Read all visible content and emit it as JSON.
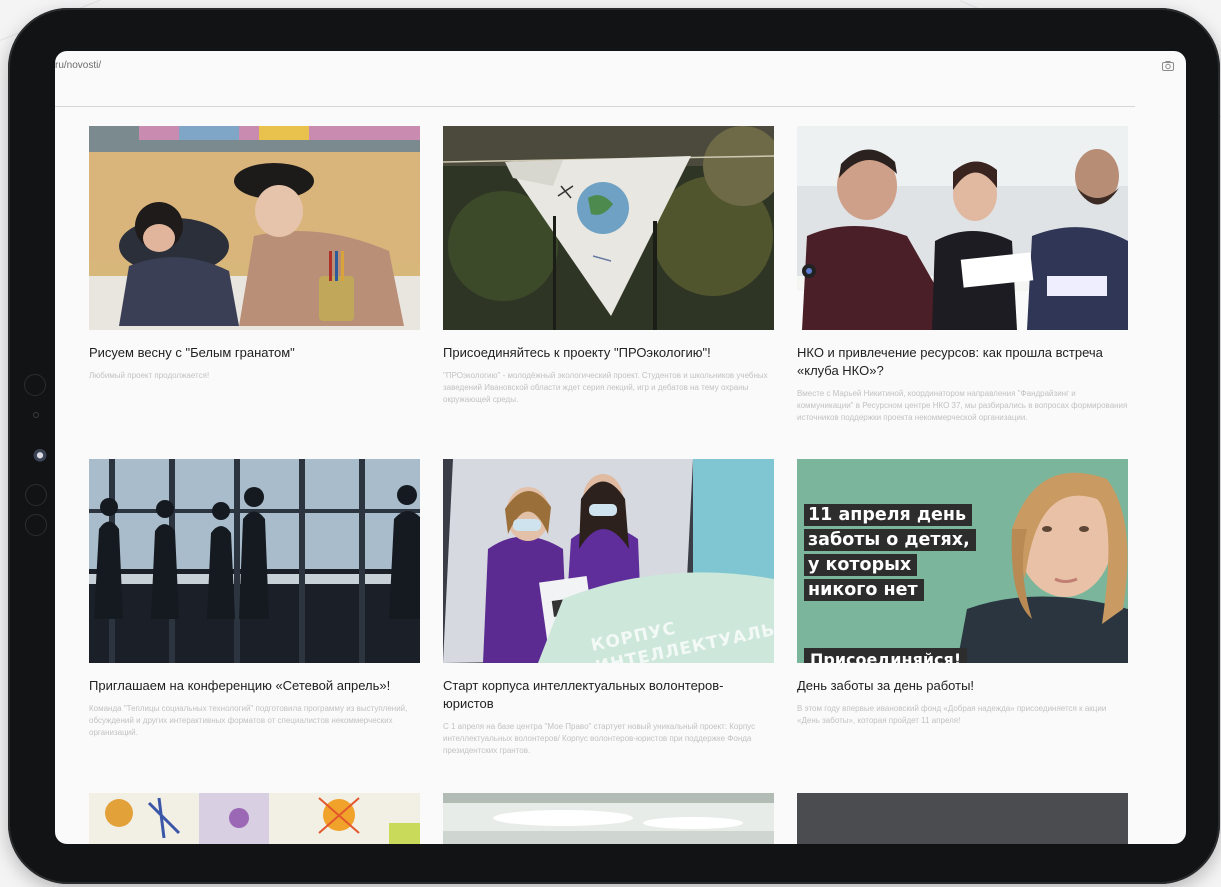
{
  "browser": {
    "url": "ru/novosti/",
    "screenshot_icon": "camera-icon"
  },
  "news": [
    {
      "title": "Рисуем весну с \"Белым гранатом\"",
      "desc": "Любимый проект продолжается!"
    },
    {
      "title": "Присоединяйтесь к проекту \"ПРОэкологию\"!",
      "desc": "\"ПРОэкологию\" - молодёжный экологический проект. Студентов и школьников учебных заведений Ивановской области ждет серия лекций, игр и дебатов на тему охраны окружающей среды."
    },
    {
      "title": "НКО и привлечение ресурсов: как прошла встреча «клуба НКО»?",
      "desc": "Вместе с Марьей Никитиной, координатором направления \"Фандрайзинг и коммуникации\" в Ресурсном центре НКО 37, мы разбирались в вопросах формирования источников поддержки проекта некоммерческой организации."
    },
    {
      "title": "Приглашаем на конференцию «Сетевой апрель»!",
      "desc": "Команда \"Теплицы социальных технологий\" подготовила программу из выступлений, обсуждений и других интерактивных форматов от специалистов некоммерческих организаций."
    },
    {
      "title": "Старт корпуса интеллектуальных волонтеров-юристов",
      "desc": "С 1 апреля на базе центра \"Мое Право\" стартует новый уникальный проект: Корпус интеллектуальных волонтеров/ Корпус волонтеров-юристов при поддержке Фонда президентских грантов.",
      "image_text": "КОРПУС\nИНТЕЛЛЕКТУАЛЬНЫХ"
    },
    {
      "title": "День заботы за день работы!",
      "desc": "В этом году впервые ивановский фонд «Добрая надежда» присоединяется к акции «День заботы», которая пройдет 11 апреля!",
      "image_text": [
        "11 апреля день",
        "заботы о детях,",
        "у которых",
        "никого нет"
      ],
      "image_text_bottom": "Присоединяйся!"
    }
  ]
}
